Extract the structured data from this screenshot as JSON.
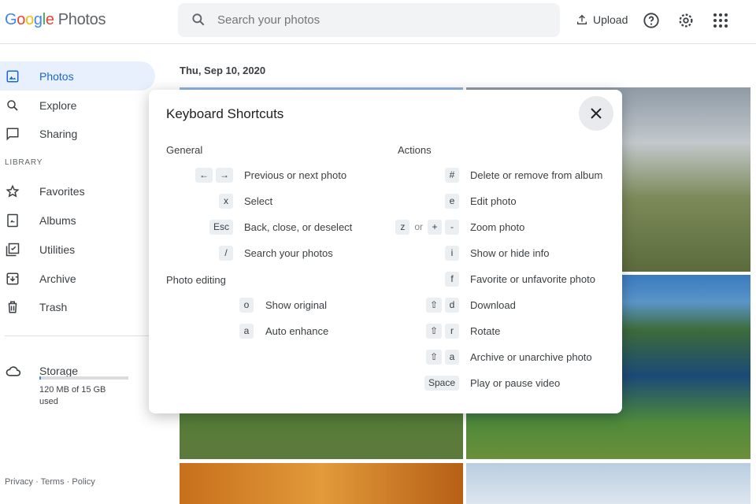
{
  "app": {
    "logo_text": "Google",
    "product": "Photos"
  },
  "search": {
    "placeholder": "Search your photos"
  },
  "header": {
    "upload_label": "Upload"
  },
  "sidebar": {
    "items": [
      {
        "label": "Photos"
      },
      {
        "label": "Explore"
      },
      {
        "label": "Sharing"
      }
    ],
    "library_heading": "LIBRARY",
    "library": [
      {
        "label": "Favorites"
      },
      {
        "label": "Albums"
      },
      {
        "label": "Utilities"
      },
      {
        "label": "Archive"
      },
      {
        "label": "Trash"
      }
    ],
    "storage": {
      "label": "Storage",
      "usage": "120 MB of 15 GB used",
      "fraction": 0.008
    },
    "footer": [
      "Privacy",
      "Terms",
      "Policy"
    ]
  },
  "main": {
    "date": "Thu, Sep 10, 2020"
  },
  "dialog": {
    "title": "Keyboard Shortcuts",
    "general": {
      "heading": "General",
      "rows": [
        {
          "keys": [
            "←",
            "→"
          ],
          "label": "Previous or next photo"
        },
        {
          "keys": [
            "x"
          ],
          "label": "Select"
        },
        {
          "keys": [
            "Esc"
          ],
          "label": "Back, close, or deselect"
        },
        {
          "keys": [
            "/"
          ],
          "label": "Search your photos"
        }
      ]
    },
    "editing": {
      "heading": "Photo editing",
      "rows": [
        {
          "keys": [
            "o"
          ],
          "label": "Show original"
        },
        {
          "keys": [
            "a"
          ],
          "label": "Auto enhance"
        }
      ]
    },
    "actions": {
      "heading": "Actions",
      "or_text": "or",
      "rows": [
        {
          "keys": [
            "#"
          ],
          "label": "Delete or remove from album"
        },
        {
          "keys": [
            "e"
          ],
          "label": "Edit photo"
        },
        {
          "keys": [
            "z",
            "+",
            "-"
          ],
          "label": "Zoom photo"
        },
        {
          "keys": [
            "i"
          ],
          "label": "Show or hide info"
        },
        {
          "keys": [
            "f"
          ],
          "label": "Favorite or unfavorite photo"
        },
        {
          "keys": [
            "⇧",
            "d"
          ],
          "label": "Download"
        },
        {
          "keys": [
            "⇧",
            "r"
          ],
          "label": "Rotate"
        },
        {
          "keys": [
            "⇧",
            "a"
          ],
          "label": "Archive or unarchive photo"
        },
        {
          "keys": [
            "Space"
          ],
          "label": "Play or pause video"
        }
      ]
    }
  }
}
